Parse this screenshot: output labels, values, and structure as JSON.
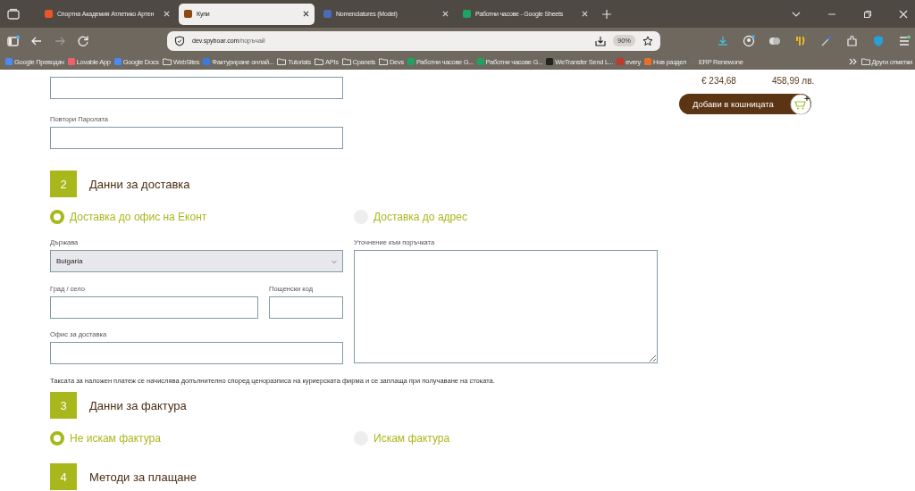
{
  "browser": {
    "tabs": [
      {
        "title": "Спортна Академия Атлетико Артен",
        "selected": false,
        "color": "#e8552a"
      },
      {
        "title": "Купи",
        "selected": true,
        "color": "#8a4a12"
      },
      {
        "title": "Nomenclatures (Model)",
        "selected": false,
        "color": "#4a6bb5"
      },
      {
        "title": "Работни часове - Google Sheets",
        "selected": false,
        "color": "#1ea362"
      }
    ],
    "address": {
      "host": "dev.spyboar.com",
      "path": "/поръчай"
    },
    "zoom": "90%",
    "bookmarks": [
      {
        "label": "Google Преводач",
        "kind": "site",
        "color": "#4a8af4"
      },
      {
        "label": "Lovable App",
        "kind": "site",
        "color": "#f0606a"
      },
      {
        "label": "Google Docs",
        "kind": "site",
        "color": "#4a8af4"
      },
      {
        "label": "WebSites",
        "kind": "folder"
      },
      {
        "label": "Фактуриране онлай...",
        "kind": "site",
        "color": "#3a7ad8"
      },
      {
        "label": "Tutorials",
        "kind": "folder"
      },
      {
        "label": "APIs",
        "kind": "folder"
      },
      {
        "label": "Cpanels",
        "kind": "folder"
      },
      {
        "label": "Devs",
        "kind": "folder"
      },
      {
        "label": "Работни часове  G...",
        "kind": "site",
        "color": "#1ea362"
      },
      {
        "label": "Работни часове  G...",
        "kind": "site",
        "color": "#1ea362"
      },
      {
        "label": "WeTransfer  Send L...",
        "kind": "site",
        "color": "#222222"
      },
      {
        "label": "every",
        "kind": "site",
        "color": "#c0392b"
      },
      {
        "label": "Нов раздел",
        "kind": "site",
        "color": "#e8702a"
      },
      {
        "label": "ERP Renewone",
        "kind": "site",
        "color": "#6f6a62"
      }
    ],
    "other_bookmarks": "Други отметки"
  },
  "page": {
    "repeat_password": {
      "label": "Повтори Паролата"
    },
    "sections": [
      {
        "number": "2",
        "title": "Данни за доставка"
      },
      {
        "number": "3",
        "title": "Данни за фактура"
      },
      {
        "number": "4",
        "title": "Методи за плащане"
      }
    ],
    "delivery_options": [
      {
        "label": "Доставка до офис на Еконт",
        "selected": true
      },
      {
        "label": "Доставка до адрес",
        "selected": false
      }
    ],
    "country": {
      "label": "Държава",
      "value": "Bulgaria"
    },
    "city": {
      "label": "Град / село"
    },
    "postcode": {
      "label": "Пощенски код"
    },
    "office": {
      "label": "Офис за доставка"
    },
    "order_note": {
      "label": "Уточнение към поръчката"
    },
    "cod_note": "Таксата за наложен платеж се начислява допълнително според ценоразписа на куриерската фирма и се заплаща при получаване на стоката.",
    "invoice_options": [
      {
        "label": "Не искам фактура",
        "selected": true
      },
      {
        "label": "Искам фактура",
        "selected": false
      }
    ],
    "price_eur": "€ 234,68",
    "price_bgn": "458,99 лв.",
    "add_to_cart": "Добави в кошницата"
  }
}
